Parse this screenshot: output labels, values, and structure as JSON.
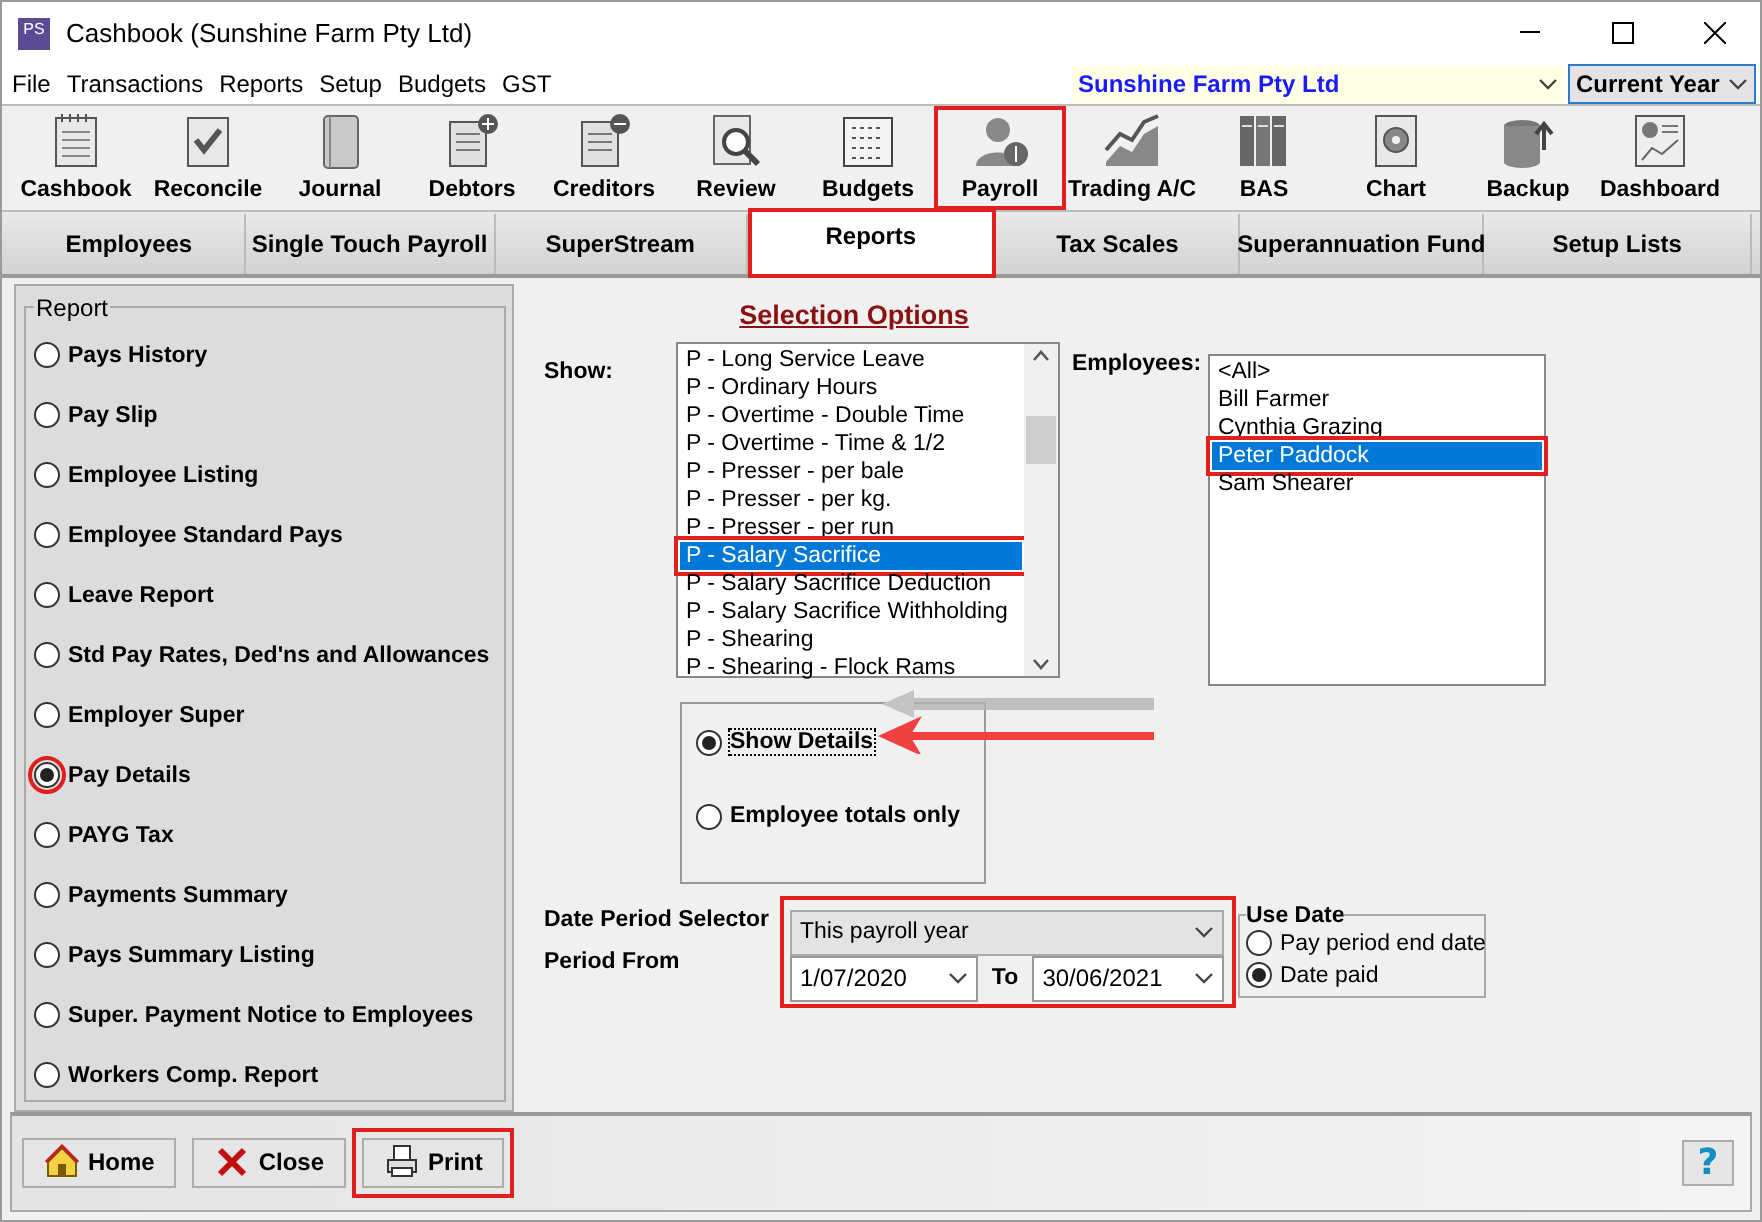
{
  "window": {
    "title": "Cashbook (Sunshine Farm Pty Ltd)",
    "app_icon": "PS"
  },
  "menu": [
    "File",
    "Transactions",
    "Reports",
    "Setup",
    "Budgets",
    "GST"
  ],
  "company_selector": {
    "value": "Sunshine Farm Pty Ltd"
  },
  "year_selector": {
    "value": "Current Year"
  },
  "toolbar": [
    {
      "label": "Cashbook",
      "kind": "cashbook",
      "highlighted": false
    },
    {
      "label": "Reconcile",
      "kind": "reconcile",
      "highlighted": false
    },
    {
      "label": "Journal",
      "kind": "journal",
      "highlighted": false
    },
    {
      "label": "Debtors",
      "kind": "debtors",
      "highlighted": false
    },
    {
      "label": "Creditors",
      "kind": "creditors",
      "highlighted": false
    },
    {
      "label": "Review",
      "kind": "review",
      "highlighted": false
    },
    {
      "label": "Budgets",
      "kind": "budgets",
      "highlighted": false
    },
    {
      "label": "Payroll",
      "kind": "payroll",
      "highlighted": true
    },
    {
      "label": "Trading A/C",
      "kind": "trading",
      "highlighted": false
    },
    {
      "label": "BAS",
      "kind": "bas",
      "highlighted": false
    },
    {
      "label": "Chart",
      "kind": "chart",
      "highlighted": false
    },
    {
      "label": "Backup",
      "kind": "backup",
      "highlighted": false
    },
    {
      "label": "Dashboard",
      "kind": "dashboard",
      "highlighted": false
    }
  ],
  "tabs": [
    {
      "label": "Employees",
      "selected": false
    },
    {
      "label": "Single Touch Payroll",
      "selected": false
    },
    {
      "label": "SuperStream",
      "selected": false
    },
    {
      "label": "Reports",
      "selected": true
    },
    {
      "label": "Tax Scales",
      "selected": false
    },
    {
      "label": "Superannuation Fund",
      "selected": false
    },
    {
      "label": "Setup Lists",
      "selected": false
    }
  ],
  "report_group": {
    "title": "Report",
    "options": [
      {
        "label": "Pays History",
        "selected": false
      },
      {
        "label": "Pay Slip",
        "selected": false
      },
      {
        "label": "Employee Listing",
        "selected": false
      },
      {
        "label": "Employee Standard Pays",
        "selected": false
      },
      {
        "label": "Leave Report",
        "selected": false
      },
      {
        "label": "Std Pay Rates, Ded'ns and Allowances",
        "selected": false
      },
      {
        "label": "Employer Super",
        "selected": false
      },
      {
        "label": "Pay Details",
        "selected": true
      },
      {
        "label": "PAYG Tax",
        "selected": false
      },
      {
        "label": "Payments Summary",
        "selected": false
      },
      {
        "label": "Pays Summary Listing",
        "selected": false
      },
      {
        "label": "Super. Payment Notice to Employees",
        "selected": false
      },
      {
        "label": "Workers Comp. Report",
        "selected": false
      }
    ]
  },
  "selection_options": {
    "title": "Selection Options",
    "show": {
      "label": "Show:",
      "items": [
        {
          "label": "P - Long Service Leave",
          "selected": false
        },
        {
          "label": "P - Ordinary Hours",
          "selected": false
        },
        {
          "label": "P - Overtime - Double Time",
          "selected": false
        },
        {
          "label": "P - Overtime - Time & 1/2",
          "selected": false
        },
        {
          "label": "P - Presser - per bale",
          "selected": false
        },
        {
          "label": "P - Presser - per kg.",
          "selected": false
        },
        {
          "label": "P - Presser - per run",
          "selected": false
        },
        {
          "label": "P - Salary Sacrifice",
          "selected": true
        },
        {
          "label": "P - Salary Sacrifice Deduction",
          "selected": false
        },
        {
          "label": "P - Salary Sacrifice Withholding",
          "selected": false
        },
        {
          "label": "P - Shearing",
          "selected": false
        },
        {
          "label": "P - Shearing - Flock Rams",
          "selected": false
        }
      ]
    },
    "employees": {
      "label": "Employees:",
      "items": [
        {
          "label": "<All>",
          "selected": false
        },
        {
          "label": "Bill Farmer",
          "selected": false
        },
        {
          "label": "Cynthia Grazing",
          "selected": false
        },
        {
          "label": "Peter Paddock",
          "selected": true
        },
        {
          "label": "Sam Shearer",
          "selected": false
        }
      ]
    },
    "detail_options": [
      {
        "label": "Show Details",
        "selected": true
      },
      {
        "label": "Employee totals only",
        "selected": false
      }
    ],
    "date_period_selector": {
      "label": "Date Period Selector",
      "value": "This payroll year"
    },
    "period": {
      "label": "Period From",
      "from": "1/07/2020",
      "to_label": "To",
      "to": "30/06/2021"
    },
    "use_date": {
      "title": "Use Date",
      "options": [
        {
          "label": "Pay period end date",
          "selected": false
        },
        {
          "label": "Date paid",
          "selected": true
        }
      ]
    }
  },
  "buttons": [
    {
      "label": "Home",
      "kind": "home",
      "highlighted": false
    },
    {
      "label": "Close",
      "kind": "close",
      "highlighted": false
    },
    {
      "label": "Print",
      "kind": "print",
      "highlighted": true
    }
  ],
  "help_button": {
    "label": "?"
  }
}
